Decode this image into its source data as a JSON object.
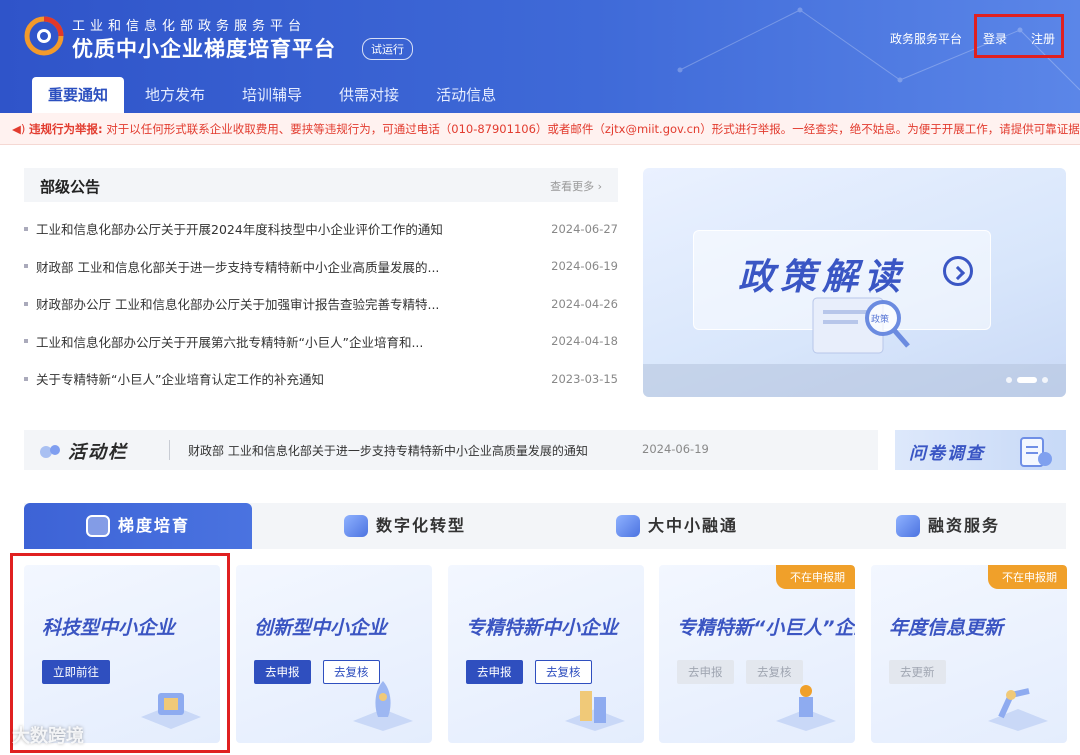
{
  "header": {
    "subtitle": "工业和信息化部政务服务平台",
    "title": "优质中小企业梯度培育平台",
    "badge": "试运行",
    "gov_link": "政务服务平台",
    "login": "登录",
    "register": "注册"
  },
  "nav": [
    "重要通知",
    "地方发布",
    "培训辅导",
    "供需对接",
    "活动信息"
  ],
  "notice": {
    "label": "违规行为举报:",
    "text": "对于以任何形式联系企业收取费用、要挟等违规行为，可通过电话（010-87901106）或者邮件（zjtx@miit.gov.cn）形式进行举报。一经查实，绝不姑息。为便于开展工作，请提供可靠证据。"
  },
  "announcements": {
    "title": "部级公告",
    "more": "查看更多 ›",
    "items": [
      {
        "title": "工业和信息化部办公厅关于开展2024年度科技型中小企业评价工作的通知",
        "date": "2024-06-27"
      },
      {
        "title": "财政部 工业和信息化部关于进一步支持专精特新中小企业高质量发展的...",
        "date": "2024-06-19"
      },
      {
        "title": "财政部办公厅 工业和信息化部办公厅关于加强审计报告查验完善专精特...",
        "date": "2024-04-26"
      },
      {
        "title": "工业和信息化部办公厅关于开展第六批专精特新“小巨人”企业培育和...",
        "date": "2024-04-18"
      },
      {
        "title": "关于专精特新“小巨人”企业培育认定工作的补充通知",
        "date": "2023-03-15"
      }
    ]
  },
  "banner": {
    "title": "政策解读",
    "tag": "政策"
  },
  "activity": {
    "label": "活动栏",
    "text": "财政部 工业和信息化部关于进一步支持专精特新中小企业高质量发展的通知",
    "date": "2024-06-19",
    "survey": "问卷调查"
  },
  "tabs": [
    "梯度培育",
    "数字化转型",
    "大中小融通",
    "融资服务"
  ],
  "cards": [
    {
      "title": "科技型中小企业",
      "tag": "",
      "buttons": [
        "立即前往"
      ]
    },
    {
      "title": "创新型中小企业",
      "tag": "",
      "buttons": [
        "去申报",
        "去复核"
      ]
    },
    {
      "title": "专精特新中小企业",
      "tag": "",
      "buttons": [
        "去申报",
        "去复核"
      ]
    },
    {
      "title": "专精特新“小巨人”企业",
      "tag": "不在申报期",
      "buttons": [
        "去申报",
        "去复核"
      ]
    },
    {
      "title": "年度信息更新",
      "tag": "不在申报期",
      "buttons": [
        "去更新"
      ]
    }
  ],
  "watermark": "大数跨境",
  "colors": {
    "primary": "#2f4fbf",
    "alert": "#e23b2e",
    "tag": "#f0a02a"
  }
}
